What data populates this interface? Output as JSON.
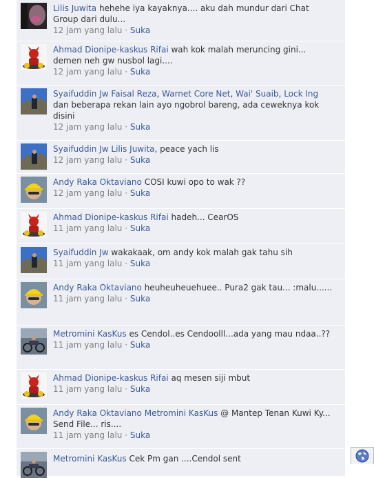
{
  "comments": [
    {
      "author": "Lilis Juwita",
      "mentions": [],
      "text": "hehehe iya kayaknya.... aku dah mundur dari Chat Group dari dulu...",
      "time": "12 jam yang lalu",
      "like": "Suka",
      "avatar": "avatar-lilis"
    },
    {
      "author": "Ahmad Dionipe-kaskus Rifai",
      "mentions": [],
      "text": "wah kok malah meruncing gini... demen neh gw nusbol lagi....",
      "time": "12 jam yang lalu",
      "like": "Suka",
      "avatar": "avatar-devil"
    },
    {
      "author": "Syaifuddin Jw",
      "mentions": [
        "Faisal Reza",
        "Warnet Core Net",
        "Wai' Suaib",
        "Lock Ing"
      ],
      "text": "dan beberapa rekan lain ayo ngobrol bareng, ada ceweknya kok disini",
      "time": "12 jam yang lalu",
      "like": "Suka",
      "avatar": "avatar-mountain"
    },
    {
      "author": "Syaifuddin Jw",
      "mentions": [
        "Lilis Juwita"
      ],
      "text": ", peace yach lis",
      "time": "12 jam yang lalu",
      "like": "Suka",
      "avatar": "avatar-mountain"
    },
    {
      "author": "Andy Raka Oktaviano",
      "mentions": [],
      "text": "COSI kuwi opo to wak ??",
      "time": "12 jam yang lalu",
      "like": "Suka",
      "avatar": "avatar-helmet"
    },
    {
      "author": "Ahmad Dionipe-kaskus Rifai",
      "mentions": [],
      "text": "hadeh... CearOS",
      "time": "11 jam yang lalu",
      "like": "Suka",
      "avatar": "avatar-devil"
    },
    {
      "author": "Syaifuddin Jw",
      "mentions": [],
      "text": "wakakaak, om andy kok malah gak tahu sih",
      "time": "11 jam yang lalu",
      "like": "Suka",
      "avatar": "avatar-mountain"
    },
    {
      "author": "Andy Raka Oktaviano",
      "mentions": [],
      "text": "heuheuheuehuee.. Pura2 gak tau... :malu......",
      "time": "11 jam yang lalu",
      "like": "Suka",
      "avatar": "avatar-helmet"
    },
    {
      "author": "Metromini KasKus",
      "mentions": [],
      "text": "es Cendol..es Cendoolll...ada yang mau ndaa..??",
      "time": "11 jam yang lalu",
      "like": "Suka",
      "avatar": "avatar-bikes"
    },
    {
      "author": "Ahmad Dionipe-kaskus Rifai",
      "mentions": [],
      "text": "aq mesen siji mbut",
      "time": "11 jam yang lalu",
      "like": "Suka",
      "avatar": "avatar-devil"
    },
    {
      "author": "Andy Raka Oktaviano",
      "mentions": [
        "Metromini KasKus"
      ],
      "text": "@ Mantep Tenan Kuwi Ky... Send File... ris....",
      "time": "11 jam yang lalu",
      "like": "Suka",
      "avatar": "avatar-helmet"
    },
    {
      "author": "Metromini KasKus",
      "mentions": [],
      "text": "Cek Pm gan ....Cendol sent",
      "time": "",
      "like": "",
      "avatar": "avatar-bikes"
    }
  ],
  "separator": " · ",
  "globe_icon": "globe-icon",
  "colors": {
    "link": "#3b5998",
    "meta": "#808080",
    "row_bg": "#edeff4"
  }
}
